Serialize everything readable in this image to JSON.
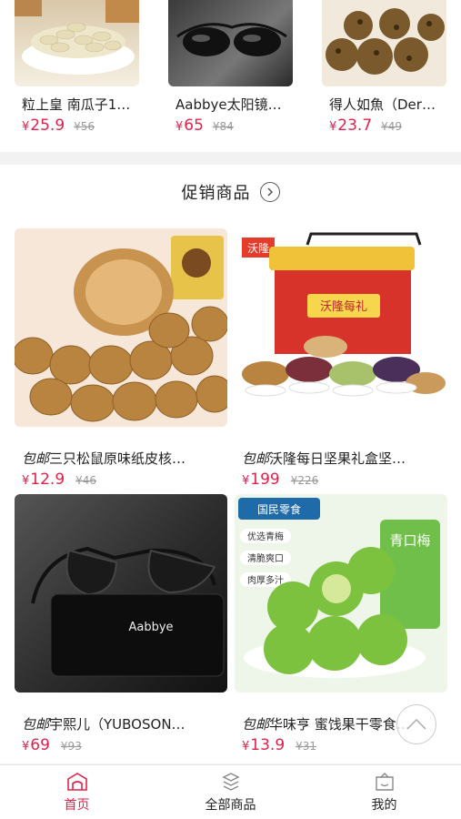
{
  "top_products": [
    {
      "title": "粒上皇 南瓜子1…",
      "price": "25.9",
      "old_price": "¥56"
    },
    {
      "title": "Aabbye太阳镜…",
      "price": "65",
      "old_price": "¥84"
    },
    {
      "title": "得人如魚（Der…",
      "price": "23.7",
      "old_price": "¥49"
    }
  ],
  "currency": "¥",
  "promo": {
    "title": "促销商品"
  },
  "products": [
    {
      "tag": "包邮",
      "title": "三只松鼠原味纸皮核…",
      "price": "12.9",
      "old_price": "¥46",
      "img_text": ""
    },
    {
      "tag": "包邮",
      "title": "沃隆每日坚果礼盒坚…",
      "price": "199",
      "old_price": "¥226",
      "img_text": "沃隆"
    },
    {
      "tag": "包邮",
      "title": "宇熙儿（YUBOSON…",
      "price": "69",
      "old_price": "¥93",
      "img_text": "Aabbye"
    },
    {
      "tag": "包邮",
      "title": "华味亨 蜜饯果干零食…",
      "price": "13.9",
      "old_price": "¥31",
      "img_text": "国民零食"
    }
  ],
  "plum_badges": [
    "优选青梅",
    "清脆爽口",
    "肉厚多汁"
  ],
  "plum_pack": "青口梅",
  "gift_box_label": "沃隆每礼",
  "tabs": [
    {
      "label": "首页",
      "icon": "home-icon",
      "active": true
    },
    {
      "label": "全部商品",
      "icon": "all-products-icon",
      "active": false
    },
    {
      "label": "我的",
      "icon": "profile-icon",
      "active": false
    }
  ],
  "colors": {
    "accent": "#e0224a",
    "old_price": "#999999"
  }
}
